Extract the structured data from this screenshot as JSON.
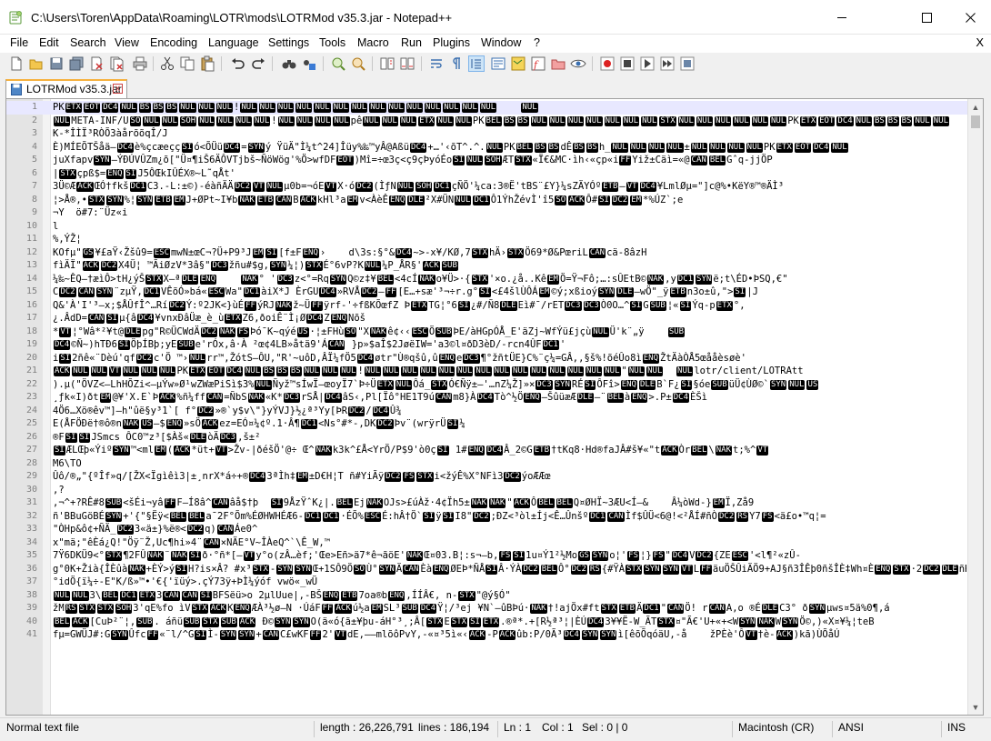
{
  "window": {
    "title": "C:\\Users\\Toren\\AppData\\Roaming\\LOTR\\mods\\LOTRMod v35.3.jar - Notepad++",
    "icons": {
      "minimize": "minimize-icon",
      "maximize": "maximize-icon",
      "close": "close-icon"
    }
  },
  "menu": {
    "items": [
      "File",
      "Edit",
      "Search",
      "View",
      "Encoding",
      "Language",
      "Settings",
      "Tools",
      "Macro",
      "Run",
      "Plugins",
      "Window",
      "?"
    ],
    "close_doc": "X"
  },
  "toolbar": {
    "buttons": [
      "new-file",
      "open-file",
      "save",
      "save-all",
      "close",
      "close-all",
      "print",
      "cut",
      "copy",
      "paste",
      "undo",
      "redo",
      "find",
      "replace",
      "zoom-in",
      "zoom-out",
      "sync-vertical",
      "sync-horizontal",
      "word-wrap",
      "show-all-characters",
      "indent-guide",
      "user-defined-language",
      "document-map",
      "function-list",
      "folder-as-workspace",
      "monitoring",
      "record-macro",
      "stop-recording",
      "playback-macro",
      "run-macro-multiple",
      "save-macro"
    ]
  },
  "tab": {
    "label": "LOTRMod v35.3.jar",
    "close": "x"
  },
  "editor": {
    "lines": [
      {
        "n": "1",
        "t": "PK\u0003\u0004\u0014\u0000\b\b\b\u0000\u0000\u0000!\u0000\u0000\u0000\u0000\u0000\u0000\u0000\u0000\u0000\u0000\u0000\u0000\u0000\u0000    \u0000"
      },
      {
        "n": "2",
        "t": "\u0000META-INF/U\u000e\u0000\u0000\u0001\u0000\u0000\u0000\u0000!\u0000\u0000\u0000\u0000pê\u0000\u0000\u0000\u0003\u0000\u0000PK\u0007\b\b\u0000\u0000\u0000\u0000\u0000\u0000\u0000\u0002\u0000\u0000\u0000\u0000\u0000\u0000PK\u0003\u0004\u0014\u0000\b\b\b\u0000\u0000"
      },
      {
        "n": "3",
        "t": "K-*ÎÌÏ³RÒÕ3àårõõqÎ/J"
      },
      {
        "n": "4",
        "t": "È)MÍEÕTŠåä—\u0014è%çcæeçç\u000fó<ÕÜü\u0014=\u0016ý ŸüÄ\"Ì¼t^24]Îüy%‰™yÂ@Aßü\u0014+…'‹õT^.^.\u0000PK\u0007\b\bdÊ\b\bh_\u0000\u0000\u0000\u0000±\u0000\u0000\u0000\u0000PK\u0003\u0004\u0014\u0000"
      },
      {
        "n": "5",
        "t": "juXfapv\u0016—ÝÐÚVÛZm¿õ[\"Ü¤¶iŠ6ÄÔVTjbš~ÑöWög'%Ö>wfDF\u0004)Mî=÷œ3ç<ç9çÞyóÉo\u000f\u0000\u0001ÆT\u0002«Ï€&MC·ìh‹«çp«i\fYiž±Cäì=«@\u0018\u0007Gˆq-jjÖP"
      },
      {
        "n": "6",
        "t": "|\u0002çpß$=\u0005\u000fJ5ÔŒkIÛÉX®~L˜qÅt'"
      },
      {
        "n": "7",
        "t": "3Ü©Æ\u0006ŒÓ†fkš\u0011C3.-L:±©)-éàñÄÄ\u0012\u000b\u0000µ0b=¬óE\u000bX·ó\u0012(ÌƒN\u0000\u0001\u0011çÑÖ'¼ca:3®Ë'tBS¨£Y}¼sZÄYÓº\u0017–\u000b\u0014¥LmlØµ=\"]c@%•KëY®™®ÄÌ³"
      },
      {
        "n": "8",
        "t": "¦>Å®,•\u0002\u0016%¦\u0016\u0017\u0019J+ØPt~I¥b\u0015\u0017\u0018B\u0006kHl³a\u0019v<ÀèÊ\u0005\u0010²X#ÜN\u0000\u0011Ô1ÝhŽévÌ'î5\u000e\u0006Ô#\u000f\u0012\u0019*%ÚZ`;e"
      },
      {
        "n": "9",
        "t": "¬Y  ö#7:¨Üz«i"
      },
      {
        "n": "10",
        "t": "l"
      },
      {
        "n": "11",
        "t": "%,ÝŽ¦"
      },
      {
        "n": "12",
        "t": "KOfµ\"\u001d¥£aŸ‹Žšû9=\u001bmwN±œC¬?Ü+P9³J\u0019\u000f[f±F\u0005›    d\\3s:§°&\u0014~>-x¥/KØ,7\u0002hÄ›\u0002Ö69*Ø&PœriL\u0018cä-8âzH"
      },
      {
        "n": "13",
        "t": "fìÄÏ\"\u0006\u0012X4Ü¦ ™ÃiØzV*3â§\"\u0013žñu#$g,\u0016¼¦)\u0002É°6vP?K\u0000¼P_ÅR§'\u0006\u001a"
      },
      {
        "n": "14",
        "t": "¼‰~ÊQ—†æìÔ>tH¿ýŠ\u0002X—ª\u0010\u0005    \u0015° '\u0013z<°=Rq\u0016Q©z‡¥\u0007<4cÍ\u0015o¥Ü>·{\u0002'×o.¿å..Kê\u0019Ö=Ÿ¬Fô;…:sÛEtB©\u0015,y\u0011\u0016ë;t\\ÉD•ÞSQ,€\""
      },
      {
        "n": "15",
        "t": "C\u0012\u0018\u0016¨zµŸ,\u0011VÊõÓ»bá«\u001bWa\"\u0011àiX*J ÈrGU\u0014»RVÅ\u0012—\f[E…+sæ'³¬÷r.g°\u000f<£4šlÙÔÁ\u0019©ý;xßioý\u0016\u0010—wÖ\"_ÿ\u0017n3o±û,\">\u000f|J"
      },
      {
        "n": "16",
        "t": "Q&'À'I'³—x;$ÅÛfÎ^…Rí\u0012Ý:º2JK<}ùÉ\fýRJ\u0015ž~Ü\fÿrf-'÷fßKÕœfZ Þ\u0003TG¦°6\u000f¿#/Ñ8\u0010Eì#¯/rET\u0013\u0013Ò0O…^\u000fG\u001a¦«\u000fÝq-p\u0003°,"
      },
      {
        "n": "17",
        "t": "¿.ÂdD=\u0018\u000fµ{â\u0014¥vnxÐâÜæ_è_ù\u0003Z6,ðoiÊ¨Ì¡Ø\u0014Z\u0005Nõš"
      },
      {
        "n": "18",
        "t": "*\u000b¦°Wâ*²¥t@\u0010pg\"R©ÜCWdÄ\u0012\u0015\u001cÞó¯K~qýé\u001f·¦±FHù\u000e\"X\u0015ê¢‹‹\u001bÖ\u001aÞE/àHGpÓÅ_E'äZj~WfÝü£jçù\u0000Ü'k¨„ÿ    \u001a"
      },
      {
        "n": "19",
        "t": "\u0014©Ñ~)hTÐ6\u000fÖþÍBþ;yE\u001ae'rÓx,â·À ²œ¢4LB»åtä9'Á\u0018 }p»$aÎ$2JøëIW='a3©l¤ðD3èD/-rcn4ÛF\u0011'"
      },
      {
        "n": "20",
        "t": "i\u000f2ñê«¨Dèú'qf\u0012c'Ö ™›\u0000rr™,ŽótS—ÔU,\"R'~uôD,ÂÏ¼fÖ5\u0014øtr\"Ù®qšû,û\u0005e\u0013¶°žñtÜE}C%¨ç¼=GÂ,,§š%!õéÛo8ì\u0005ŽtÄàÒÅ5œååèsøè'"
      },
      {
        "n": "21",
        "t": "\u0006\u0000\u0000\u000b\u0000\u0000\u0000PK\u0003\u0004\u0014\u0000\b\b\b\u0000\u0000\u0000!\u0000\u0000\u0000\u0000\u0000\u0000\u0000\u0000\u0000\u0000\u0000\u0000\u0000\u0000\"\u0000\u0000  \u0000lotr/client/LOTRAtt"
      },
      {
        "n": "22",
        "t": ").µ(\"ÖVZ<–LhHÕZi<–µÝw»Ø¹wZWæPiSì$3%\u0000Ñyž™sÍwÏ—œoyÏ7`Þ÷Ü\u0003\u0000Ôá_\u0002Ó€Ñÿ±—'…nZ¼Ž]»×\u0013\u0016RÉ\u000fÔFî>\u0005\u0010B`F¿\u000f§óe\u001aüÜ¢ÙØ©`\u0016\u0000\u001f"
      },
      {
        "n": "23",
        "t": "¸ƒk«I)ðt\u0019@¥'X.E`Þ\u0006%ñ¼ff\u0018=ÑbS\u0015«K*\u0013rSÅ|\u0014âS‹,Pl[Ïô°HE1T9ú\u0018m8}À\u0014Tò^½Ö\u0005—ŠûüæÆ\u0010—¨\u0007à\u0005>.P±\u0014ÈŠì"
      },
      {
        "n": "24",
        "t": "4Ö6…Xö®êv™]—h\"ûë§y³1`[ f°\u0012»®`y$v\\\"}yÝVJ}½¿ª³Yy[ÞR\u0012/\u0014Û¾"
      },
      {
        "n": "25",
        "t": "E(ÅFÖÐë†®ô®n\u0015\u001f–$\u0005»sÖ\u0006ez=EÓ¤¼¢º.1·Â¶\u0011<Ns°#*-,DK\u0012Þv¨(wrÿrÜ\u000f¼"
      },
      {
        "n": "26",
        "t": "®F\u000f\u000fJSmcs ÔC0™z³[$Àš«\u0010òÄ\u0013,š±²"
      },
      {
        "n": "27",
        "t": "\u000fÆLŒþ«Ýiº\u0016™<ml\u0019(\u0006*üt+\u000b>Žv-|ðéšÖ'@÷ Œ^\u0015k3k^£Å<YrÖ/P$9'ò0ç\u000f 1#\u0005\u0014Â_2©G\u0017†tKq8·Hd®faJÂ#š¥«\"t\u0006Òr\u0007\\\u0015t;%^\u000b"
      },
      {
        "n": "28",
        "t": "M6\\TO"
      },
      {
        "n": "29",
        "t": "Ûô/®„\"{ºÎf»q/[ŽX<Ïgìêì3|±¸nrX*á÷+®\u00143ªÌh‡\u0019±D€H¦T ñ#YiÃÿ\u0012\u001c\u0002i<žýÊ%X°NFì3\u0012ýoÆÆœ"
      },
      {
        "n": "30",
        "t": ",?"
      },
      {
        "n": "31",
        "t": ",¬^+?RÊ#8\u001a<šÉi¬yâ\fF—Í8â^\u0018âå$†þ  \u000f9ÅzŸˆK¿|.\u0007Ej\u0015OJs>£úÀž·4¢Ïh5±\u0015\u0015\"\u0006Ô\u0007\u0007Q¤ØHÏ~3ÆU<Í–&    Â¼òWd-}\u0019Ï,Zå9"
      },
      {
        "n": "32",
        "t": "ñ'BBuGöBÉ\u0016+'{\"§Ëÿ<\u0007\u0007a¯2F°Õm%ÉØHWHÉÆ6-\u0011\u0011·ÉÕ%\u001bÉ:hÂ†Ö`\u000fÿ\u000fI8\"\u0012;ÐZ<³òl±Íj<Ê…Ûnšº\u0011\u0018Ìf$ÛÜ<6@!<²ÅÍ#ñÒ\u0012\u001eY7\u001c<ä£o•™q¦="
      },
      {
        "n": "33",
        "t": "\"ÒHp&ô¢+ÑÄ_\u00123«ä±}%ë®<\u0012q)\u0018Áe0^"
      },
      {
        "n": "34",
        "t": "x\"mä;\"êÈá¿Q!\"Öÿ¨Ž,Uc¶hi»4¨\u0018×NÄE°V~ÎÀeQ^`\\Ê_W,™"
      },
      {
        "n": "35",
        "t": "7Ÿ6DKÜ9<°\u0002¶2FÛ\u0015¨\u0015\u000fð·°ñ*[—\u000by°o(zÂ…èf;'Œe>Eñ>ä7*ê¬ãöE'\u0015Œ¤03.B¦:s¬—b,\u001c\u000f1u¤Ý1²½Mo\u001d\u0016o¦'\u001c¦}\u001c\"\u0014V\u0012{ZE\u001b'<l¶²«zÛ-"
      },
      {
        "n": "36",
        "t": "g°0K+Žià{ÎÈûà\u0015+ÈÝ>ý\u000fH?is×Â? #x³\u0002-\u0016\u0016Œ+1SÔ9Ö\u000eÙ°\u0016Ä\u0018Èà\u0005ØEÞ*ÑÅ\u000fÂ·ÝÀ\u0012\u0007Ô°\u0012\u001e{#ŸÀ\u0002\u0016\u0016\u000bL\fäuÖŠÛiÄÖ9+AJ§ñ3ÎÊþ0ñšÎÈ‡Wh¤È\u0005\u0002·2\u0012\u0010ñKuÊÎ"
      },
      {
        "n": "37",
        "t": "°idÖ{ï¼÷-E\"K/ß»™•'€{'ïüý>.çÝ73ÿ+ÞÌ¼ýóf vwö«_wÜ"
      },
      {
        "n": "38",
        "t": "\u0000\u00003\\\u0007\u0011\u00033\u0018\u0018\u000fBFSëü>o 2µlUue|,-BŠ\u0005\u00177oa®b\u0005,ÍÍÂ€, n-\u0002\"@ý§Ó\""
      },
      {
        "n": "39",
        "t": "žM\u001e\u0002\u0002\u00013'qE%fo ìV\u0002\u0006K\u0005ÆÀ³½ø—N ·ÚáF\f\u0006ú½a\u0019SL³\u001a\u0014Ÿ¦/³ej ¥N`—ûBÞú·\u0015†!ajÖx#ft\u0002\u0017Ä\u0011\"\u0018Ö! r\u0018A,o ®É\u0010C3° ð\u0016µws¤5ä%0¶,á"
      },
      {
        "n": "40",
        "t": "\u0007\u0006[CuÞ²¨¦,\u001a. áñü\u001a\u0002\u001a\u0006 Ð©\u0016\u0016O(ä«ó{ã±¥þu-áH°³¸;Â[\u0002E\u0002\u000f\u0003.®ª*.+[R½ª³¦|ÈÚ\u00143¥¥Ë-W_ÃT\u0002¤\"Ã€'U+«+<W\u0016\u0015W\u0016Ö©,)«X¤¥¼¦teB"
      },
      {
        "n": "41",
        "t": "fµ=GWÜJ#:G\u0016Ûfc\f«¨l/^G\u000fÌ-\u0016\u0016+\u0018C£wKF\f2'\u000bdE,——mlõôPvY,-«¤³5ì«‹\u0006-P\u0006ûb:P/0Ã³\u0014\u0016\u0016ì[êõÕqóäU,-å    žPÈè'Ô\u000b†è-\u0006)kã)ÙÕåÚ"
      }
    ]
  },
  "status": {
    "file_type": "Normal text file",
    "length": "length : 26,226,791",
    "lines": "lines : 186,194",
    "ln": "Ln : 1",
    "col": "Col : 1",
    "sel": "Sel : 0 | 0",
    "eol": "Macintosh (CR)",
    "encoding": "ANSI",
    "mode": "INS"
  }
}
